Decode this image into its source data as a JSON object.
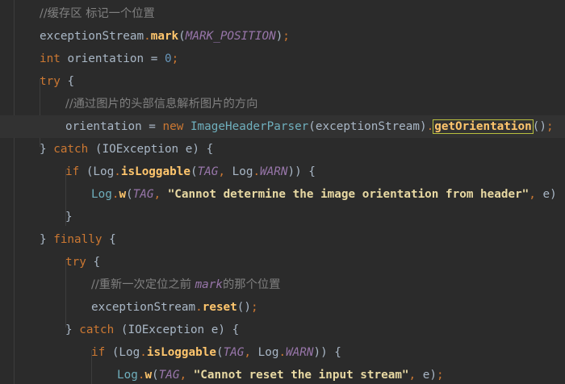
{
  "editor": {
    "lines": [
      {
        "indent": 1,
        "current": false,
        "tokens": [
          {
            "t": "comment",
            "v": "//缓存区 标记一个位置"
          }
        ]
      },
      {
        "indent": 1,
        "current": false,
        "tokens": [
          {
            "t": "plain",
            "v": "exceptionStream"
          },
          {
            "t": "dot",
            "v": "."
          },
          {
            "t": "meth",
            "v": "mark"
          },
          {
            "t": "plain",
            "v": "("
          },
          {
            "t": "const",
            "v": "MARK_POSITION"
          },
          {
            "t": "plain",
            "v": ")"
          },
          {
            "t": "dot",
            "v": ";"
          }
        ]
      },
      {
        "indent": 1,
        "current": false,
        "tokens": [
          {
            "t": "kw",
            "v": "int "
          },
          {
            "t": "plain",
            "v": "orientation = "
          },
          {
            "t": "num",
            "v": "0"
          },
          {
            "t": "dot",
            "v": ";"
          }
        ]
      },
      {
        "indent": 1,
        "current": false,
        "tokens": [
          {
            "t": "kw",
            "v": "try "
          },
          {
            "t": "plain",
            "v": "{"
          }
        ]
      },
      {
        "indent": 2,
        "current": false,
        "tokens": [
          {
            "t": "comment",
            "v": "//通过图片的头部信息解析图片的方向"
          }
        ]
      },
      {
        "indent": 2,
        "current": true,
        "tokens": [
          {
            "t": "plain",
            "v": "orientation = "
          },
          {
            "t": "kw",
            "v": "new "
          },
          {
            "t": "cls",
            "v": "ImageHeaderParser"
          },
          {
            "t": "plain",
            "v": "(exceptionStream)"
          },
          {
            "t": "dot",
            "v": "."
          },
          {
            "t": "methhl",
            "v": "getOrientation"
          },
          {
            "t": "plain",
            "v": "()"
          },
          {
            "t": "dot",
            "v": ";"
          }
        ]
      },
      {
        "indent": 1,
        "current": false,
        "tokens": [
          {
            "t": "plain",
            "v": "} "
          },
          {
            "t": "kw",
            "v": "catch "
          },
          {
            "t": "plain",
            "v": "(IOException e) {"
          }
        ]
      },
      {
        "indent": 2,
        "current": false,
        "tokens": [
          {
            "t": "kw",
            "v": "if "
          },
          {
            "t": "plain",
            "v": "(Log"
          },
          {
            "t": "dot",
            "v": "."
          },
          {
            "t": "meth",
            "v": "isLoggable"
          },
          {
            "t": "plain",
            "v": "("
          },
          {
            "t": "const",
            "v": "TAG"
          },
          {
            "t": "dot",
            "v": ", "
          },
          {
            "t": "plain",
            "v": "Log"
          },
          {
            "t": "dot",
            "v": "."
          },
          {
            "t": "const",
            "v": "WARN"
          },
          {
            "t": "plain",
            "v": ")) {"
          }
        ]
      },
      {
        "indent": 3,
        "current": false,
        "tokens": [
          {
            "t": "cls",
            "v": "Log"
          },
          {
            "t": "dot",
            "v": "."
          },
          {
            "t": "meth",
            "v": "w"
          },
          {
            "t": "plain",
            "v": "("
          },
          {
            "t": "const",
            "v": "TAG"
          },
          {
            "t": "dot",
            "v": ", "
          },
          {
            "t": "str",
            "v": "\"Cannot determine the image orientation from header\""
          },
          {
            "t": "dot",
            "v": ", "
          },
          {
            "t": "plain",
            "v": "e)"
          }
        ]
      },
      {
        "indent": 2,
        "current": false,
        "tokens": [
          {
            "t": "plain",
            "v": "}"
          }
        ]
      },
      {
        "indent": 1,
        "current": false,
        "tokens": [
          {
            "t": "plain",
            "v": "} "
          },
          {
            "t": "kw",
            "v": "finally "
          },
          {
            "t": "plain",
            "v": "{"
          }
        ]
      },
      {
        "indent": 2,
        "current": false,
        "tokens": [
          {
            "t": "kw",
            "v": "try "
          },
          {
            "t": "plain",
            "v": "{"
          }
        ]
      },
      {
        "indent": 3,
        "current": false,
        "tokens": [
          {
            "t": "comment",
            "v": "//重新一次定位之前 "
          },
          {
            "t": "kwit",
            "v": "mark"
          },
          {
            "t": "comment",
            "v": "的那个位置"
          }
        ]
      },
      {
        "indent": 3,
        "current": false,
        "tokens": [
          {
            "t": "plain",
            "v": "exceptionStream"
          },
          {
            "t": "dot",
            "v": "."
          },
          {
            "t": "meth",
            "v": "reset"
          },
          {
            "t": "plain",
            "v": "()"
          },
          {
            "t": "dot",
            "v": ";"
          }
        ]
      },
      {
        "indent": 2,
        "current": false,
        "tokens": [
          {
            "t": "plain",
            "v": "} "
          },
          {
            "t": "kw",
            "v": "catch "
          },
          {
            "t": "plain",
            "v": "(IOException e) {"
          }
        ]
      },
      {
        "indent": 3,
        "current": false,
        "tokens": [
          {
            "t": "kw",
            "v": "if "
          },
          {
            "t": "plain",
            "v": "(Log"
          },
          {
            "t": "dot",
            "v": "."
          },
          {
            "t": "meth",
            "v": "isLoggable"
          },
          {
            "t": "plain",
            "v": "("
          },
          {
            "t": "const",
            "v": "TAG"
          },
          {
            "t": "dot",
            "v": ", "
          },
          {
            "t": "plain",
            "v": "Log"
          },
          {
            "t": "dot",
            "v": "."
          },
          {
            "t": "const",
            "v": "WARN"
          },
          {
            "t": "plain",
            "v": ")) {"
          }
        ]
      },
      {
        "indent": 4,
        "current": false,
        "tokens": [
          {
            "t": "cls",
            "v": "Log"
          },
          {
            "t": "dot",
            "v": "."
          },
          {
            "t": "meth",
            "v": "w"
          },
          {
            "t": "plain",
            "v": "("
          },
          {
            "t": "const",
            "v": "TAG"
          },
          {
            "t": "dot",
            "v": ", "
          },
          {
            "t": "str",
            "v": "\"Cannot reset the input stream\""
          },
          {
            "t": "dot",
            "v": ", "
          },
          {
            "t": "plain",
            "v": "e)"
          },
          {
            "t": "dot",
            "v": ";"
          }
        ]
      }
    ]
  },
  "colors": {
    "background": "#2b2b2b",
    "current_line": "#323232",
    "keyword": "#cc7832",
    "comment": "#808080",
    "number": "#6897bb",
    "constant": "#9876aa",
    "string": "#e8d9a3",
    "method": "#ffc66d",
    "class": "#6fafbd",
    "text": "#a9b7c6"
  }
}
